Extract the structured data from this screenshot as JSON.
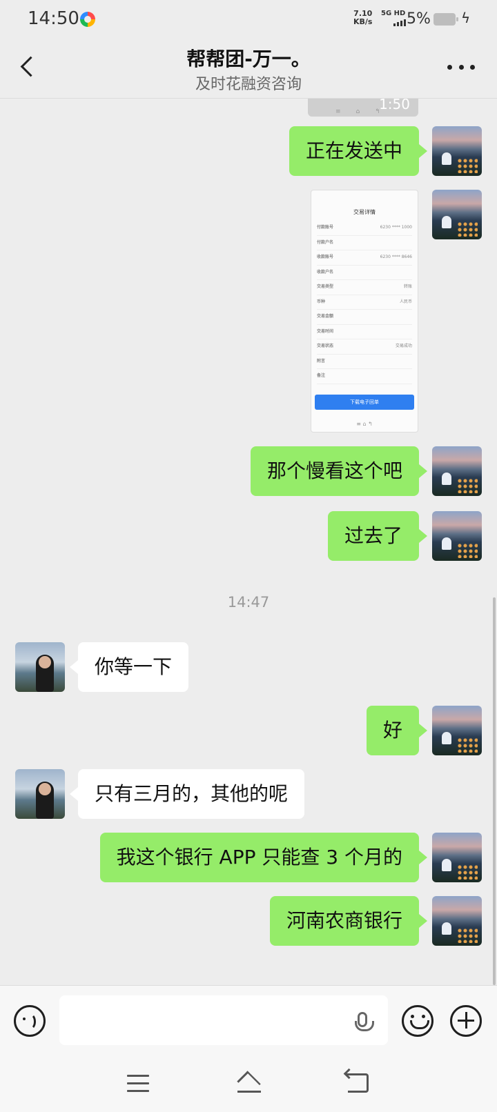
{
  "status_bar": {
    "time": "14:50",
    "net_speed_value": "7.10",
    "net_speed_unit": "KB/s",
    "network": "5G HD",
    "battery": "5%"
  },
  "header": {
    "title": "帮帮团-万一。",
    "subtitle": "及时花融资咨询"
  },
  "messages": [
    {
      "side": "me",
      "text": "正在发送中"
    },
    {
      "side": "me",
      "type": "image",
      "screenshot": {
        "header": "交易详情",
        "rows": [
          {
            "label": "付款账号",
            "value": "6230 **** 1000"
          },
          {
            "label": "付款户名",
            "value": ""
          },
          {
            "label": "收款账号",
            "value": "6230 **** 8646"
          },
          {
            "label": "收款户名",
            "value": ""
          },
          {
            "label": "交易类型",
            "value": "转账"
          },
          {
            "label": "币种",
            "value": "人民币"
          },
          {
            "label": "交易金额",
            "value": ""
          },
          {
            "label": "交易时间",
            "value": ""
          },
          {
            "label": "交易状态",
            "value": "交易成功"
          },
          {
            "label": "附言",
            "value": ""
          },
          {
            "label": "备注",
            "value": ""
          }
        ],
        "button": "下载电子回单"
      }
    },
    {
      "side": "me",
      "text": "那个慢看这个吧"
    },
    {
      "side": "me",
      "text": "过去了"
    },
    {
      "side": "other",
      "text": "你等一下"
    },
    {
      "side": "me",
      "text": "好"
    },
    {
      "side": "other",
      "text": "只有三月的，其他的呢"
    },
    {
      "side": "me",
      "text": "我这个银行 APP 只能查 3 个月的"
    },
    {
      "side": "me",
      "text": "河南农商银行"
    }
  ],
  "timestamp_1": "14:47",
  "previous_image_time": "1:50",
  "colors": {
    "my_bubble": "#95ec69",
    "other_bubble": "#ffffff",
    "background": "#ededed"
  },
  "input": {
    "placeholder": ""
  },
  "icons": {
    "back": "chevron-left-icon",
    "more": "more-dots-icon",
    "voice": "voice-icon",
    "mic": "mic-icon",
    "emoji": "emoji-icon",
    "plus": "plus-icon"
  }
}
